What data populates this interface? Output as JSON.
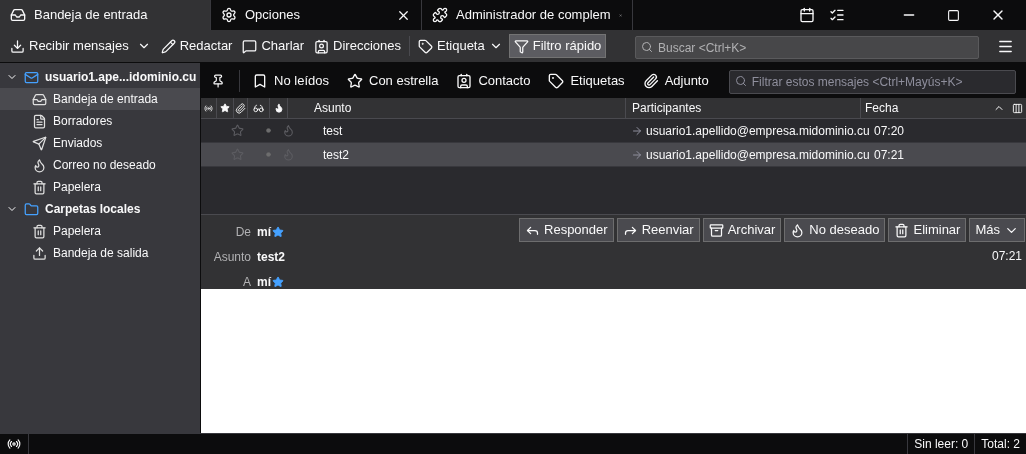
{
  "tabs": [
    {
      "kind": "inbox",
      "label": "Bandeja de entrada",
      "selected": true
    },
    {
      "kind": "gear",
      "label": "Opciones",
      "selected": false
    },
    {
      "kind": "puzzle",
      "label": "Administrador de complem",
      "selected": false
    }
  ],
  "toolbar": [
    {
      "kind": "download",
      "label": "Recibir mensajes",
      "dropdown": true,
      "pressed": false
    },
    {
      "kind": "pencil",
      "label": "Redactar",
      "dropdown": false,
      "pressed": false
    },
    {
      "kind": "chat",
      "label": "Charlar",
      "dropdown": false,
      "pressed": false
    },
    {
      "kind": "contacts",
      "label": "Direcciones",
      "dropdown": false,
      "pressed": false
    },
    {
      "kind": "tag",
      "label": "Etiqueta",
      "dropdown": true,
      "pressed": false
    },
    {
      "kind": "filter",
      "label": "Filtro rápido",
      "dropdown": false,
      "pressed": true
    }
  ],
  "search": {
    "placeholder": "Buscar <Ctrl+K>"
  },
  "folders": [
    {
      "kind": "account",
      "label": "usuario1.ape...idominio.cu",
      "expanded": true,
      "selected": false,
      "children": [
        {
          "kind": "inbox",
          "label": "Bandeja de entrada",
          "selected": true
        },
        {
          "kind": "drafts",
          "label": "Borradores",
          "selected": false
        },
        {
          "kind": "sent",
          "label": "Enviados",
          "selected": false
        },
        {
          "kind": "junk",
          "label": "Correo no deseado",
          "selected": false
        },
        {
          "kind": "trash",
          "label": "Papelera",
          "selected": false
        }
      ]
    },
    {
      "kind": "local",
      "label": "Carpetas locales",
      "expanded": true,
      "selected": false,
      "children": [
        {
          "kind": "trash",
          "label": "Papelera",
          "selected": false
        },
        {
          "kind": "outbox",
          "label": "Bandeja de salida",
          "selected": false
        }
      ]
    }
  ],
  "quick_filter": {
    "items": [
      {
        "kind": "unread",
        "label": "No leídos",
        "selected": false
      },
      {
        "kind": "star",
        "label": "Con estrella",
        "selected": false
      },
      {
        "kind": "contact",
        "label": "Contacto",
        "selected": false
      },
      {
        "kind": "tag",
        "label": "Etiquetas",
        "selected": false
      },
      {
        "kind": "attach",
        "label": "Adjunto",
        "selected": false
      }
    ],
    "placeholder": "Filtrar estos mensajes <Ctrl+Mayús+K>"
  },
  "columns": [
    "Asunto",
    "Participantes",
    "Fecha"
  ],
  "messages": [
    {
      "subject": "test",
      "participant": "usuario1.apellido@empresa.midominio.cu",
      "date": "07:20",
      "selected": false,
      "starred": false
    },
    {
      "subject": "test2",
      "participant": "usuario1.apellido@empresa.midominio.cu",
      "date": "07:21",
      "selected": true,
      "starred": false
    }
  ],
  "header": {
    "from_label": "De",
    "from": "mí",
    "subject_label": "Asunto",
    "subject": "test2",
    "to_label": "A",
    "to": "mí",
    "date": "07:21"
  },
  "actions": [
    {
      "kind": "reply",
      "label": "Responder"
    },
    {
      "kind": "forward",
      "label": "Reenviar"
    },
    {
      "kind": "archive",
      "label": "Archivar"
    },
    {
      "kind": "junk",
      "label": "No deseado"
    },
    {
      "kind": "trash",
      "label": "Eliminar"
    },
    {
      "kind": "more",
      "label": "Más"
    }
  ],
  "status": {
    "unread": "Sin leer: 0",
    "total": "Total: 2"
  }
}
